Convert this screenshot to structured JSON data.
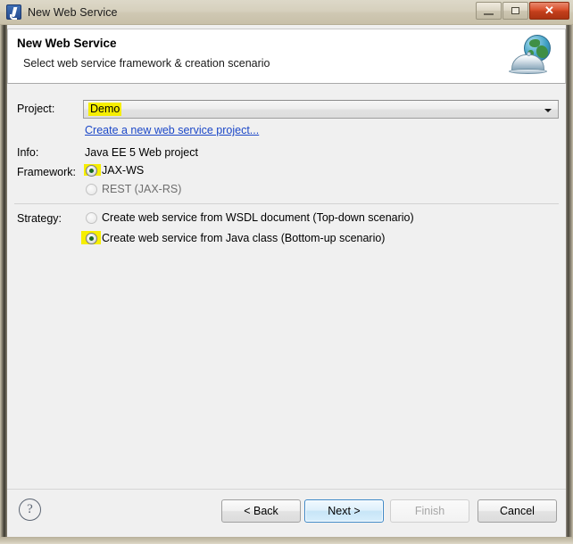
{
  "window": {
    "title": "New Web Service",
    "icon": "app-icon",
    "controls": {
      "minimize": "minimize-icon",
      "maximize": "maximize-icon",
      "close": "✕"
    }
  },
  "header": {
    "title": "New Web Service",
    "subtitle": "Select web service framework & creation scenario",
    "icon": "web-service-globe-icon"
  },
  "form": {
    "project": {
      "label": "Project:",
      "value": "Demo",
      "highlighted": true,
      "highlight_color": "#f6ee00"
    },
    "create_project_link": "Create a new web service project...",
    "info": {
      "label": "Info:",
      "value": "Java EE 5 Web project"
    },
    "framework": {
      "label": "Framework:",
      "options": [
        {
          "label": "JAX-WS",
          "selected": true,
          "highlighted": true
        },
        {
          "label": "REST (JAX-RS)",
          "selected": false,
          "highlighted": false
        }
      ]
    },
    "strategy": {
      "label": "Strategy:",
      "options": [
        {
          "label": "Create web service from WSDL document (Top-down scenario)",
          "selected": false,
          "highlighted": false
        },
        {
          "label": "Create web service from Java class (Bottom-up scenario)",
          "selected": true,
          "highlighted": true
        }
      ]
    }
  },
  "footer": {
    "help": "?",
    "buttons": [
      {
        "label": "< Back",
        "state": "enabled"
      },
      {
        "label": "Next >",
        "state": "focused"
      },
      {
        "label": "Finish",
        "state": "disabled"
      },
      {
        "label": "Cancel",
        "state": "enabled"
      }
    ]
  },
  "colors": {
    "highlight": "#f6ee00",
    "link": "#1c48c8",
    "titlebar": "#d6d0bd",
    "body": "#f0f0f0",
    "radio_dot": "#1c6b20",
    "focus_border": "#3d88c7"
  }
}
